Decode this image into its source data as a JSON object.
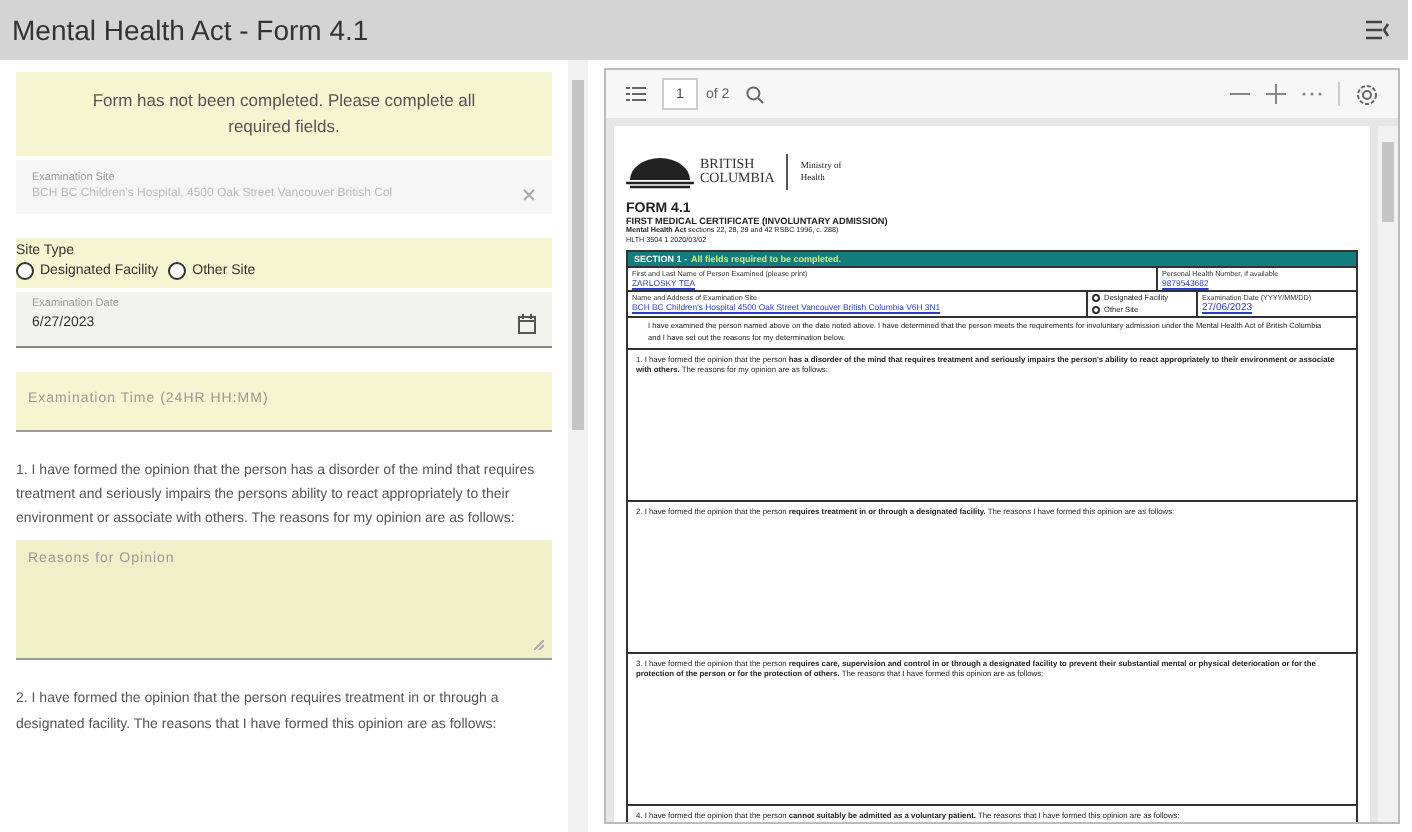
{
  "header": {
    "title": "Mental Health Act - Form 4.1"
  },
  "form": {
    "alert": "Form has not been completed. Please complete all required fields.",
    "fields": [
      {
        "kind": "text",
        "label": "Examination Site",
        "value": "BCH BC Children's Hospital, 4500 Oak Street Vancouver British Col",
        "disabled": true
      },
      {
        "kind": "radio",
        "label": "Site Type",
        "options": [
          {
            "label": "Designated Facility",
            "selected": false
          },
          {
            "label": "Other Site",
            "selected": false
          }
        ]
      },
      {
        "kind": "date",
        "label": "Examination Date",
        "value": "6/27/2023"
      },
      {
        "kind": "input",
        "placeholder": "Examination Time (24HR HH:MM)"
      },
      {
        "kind": "paragraph",
        "text": "1. I have formed the opinion that the person has a disorder of the mind that requires treatment and seriously impairs the persons ability to react appropriately to their environment or associate with others. The reasons for my opinion are as follows:"
      },
      {
        "kind": "textarea",
        "placeholder": "Reasons for Opinion"
      },
      {
        "kind": "paragraph",
        "text": "2. I have formed the opinion that the person requires treatment in or through a designated facility. The reasons that I have formed this opinion are as follows:"
      }
    ]
  },
  "viewer": {
    "toolbar": {
      "page": "1",
      "page_count": "of 2"
    },
    "document": {
      "logo_lines": [
        "BRITISH",
        "COLUMBIA"
      ],
      "ministry_lines": [
        "Ministry of",
        "Health"
      ],
      "form_number": "FORM 4.1",
      "form_title": "FIRST MEDICAL CERTIFICATE (INVOLUNTARY ADMISSION)",
      "act_line": "**Mental Health Act** sections 22, 28, 29 and 42 RSBC 1996, c. 288)",
      "form_code": "HLTH 3504 1 2020/03/02",
      "section_title": "SECTION 1 -",
      "section_note": "All fields required to be completed.",
      "name_label": "First and Last Name of Person Examined (please print)",
      "name_value": "ZARLOSKY TEA",
      "phn_label": "Personal Health Number, if available",
      "phn_value": "9879543682",
      "site_label": "Name and Address of Examination Site",
      "site_value": "BCH BC Children's Hospital 4500 Oak Street Vancouver British Columbia V6H 3N1",
      "site_options": [
        {
          "label": "Designated Facility",
          "selected": false
        },
        {
          "label": "Other Site",
          "selected": false
        }
      ],
      "date_label": "Examination Date (YYYY/MM/DD)",
      "date_value": "27/06/2023",
      "intro": "I have examined the person named above on the date noted above. I have determined that the person meets the requirements for involuntary admission under the Mental Health Act of British Columbia and I have set out the reasons for my determination below.",
      "opinions": [
        "1. I have formed the opinion that the person **has a disorder of the mind that requires treatment and seriously impairs the person's ability to react appropriately to their environment or associate with others.** The reasons for my opinion are as follows:",
        "2. I have formed the opinion that the person **requires treatment in or through a designated facility.** The reasons I have formed this opinion are as follows:",
        "3. I have formed the opinion that the person **requires care, supervision and control in or through a designated facility to prevent their substantial mental or physical deterioration or for the protection of the person or for the protection of others.** The reasons that I have formed this opinion are as follows:",
        "4. I have formed the opinion that the person **cannot suitably be admitted as a voluntary patient.** The reasons that I have formed this opinion are as follows:"
      ]
    }
  }
}
